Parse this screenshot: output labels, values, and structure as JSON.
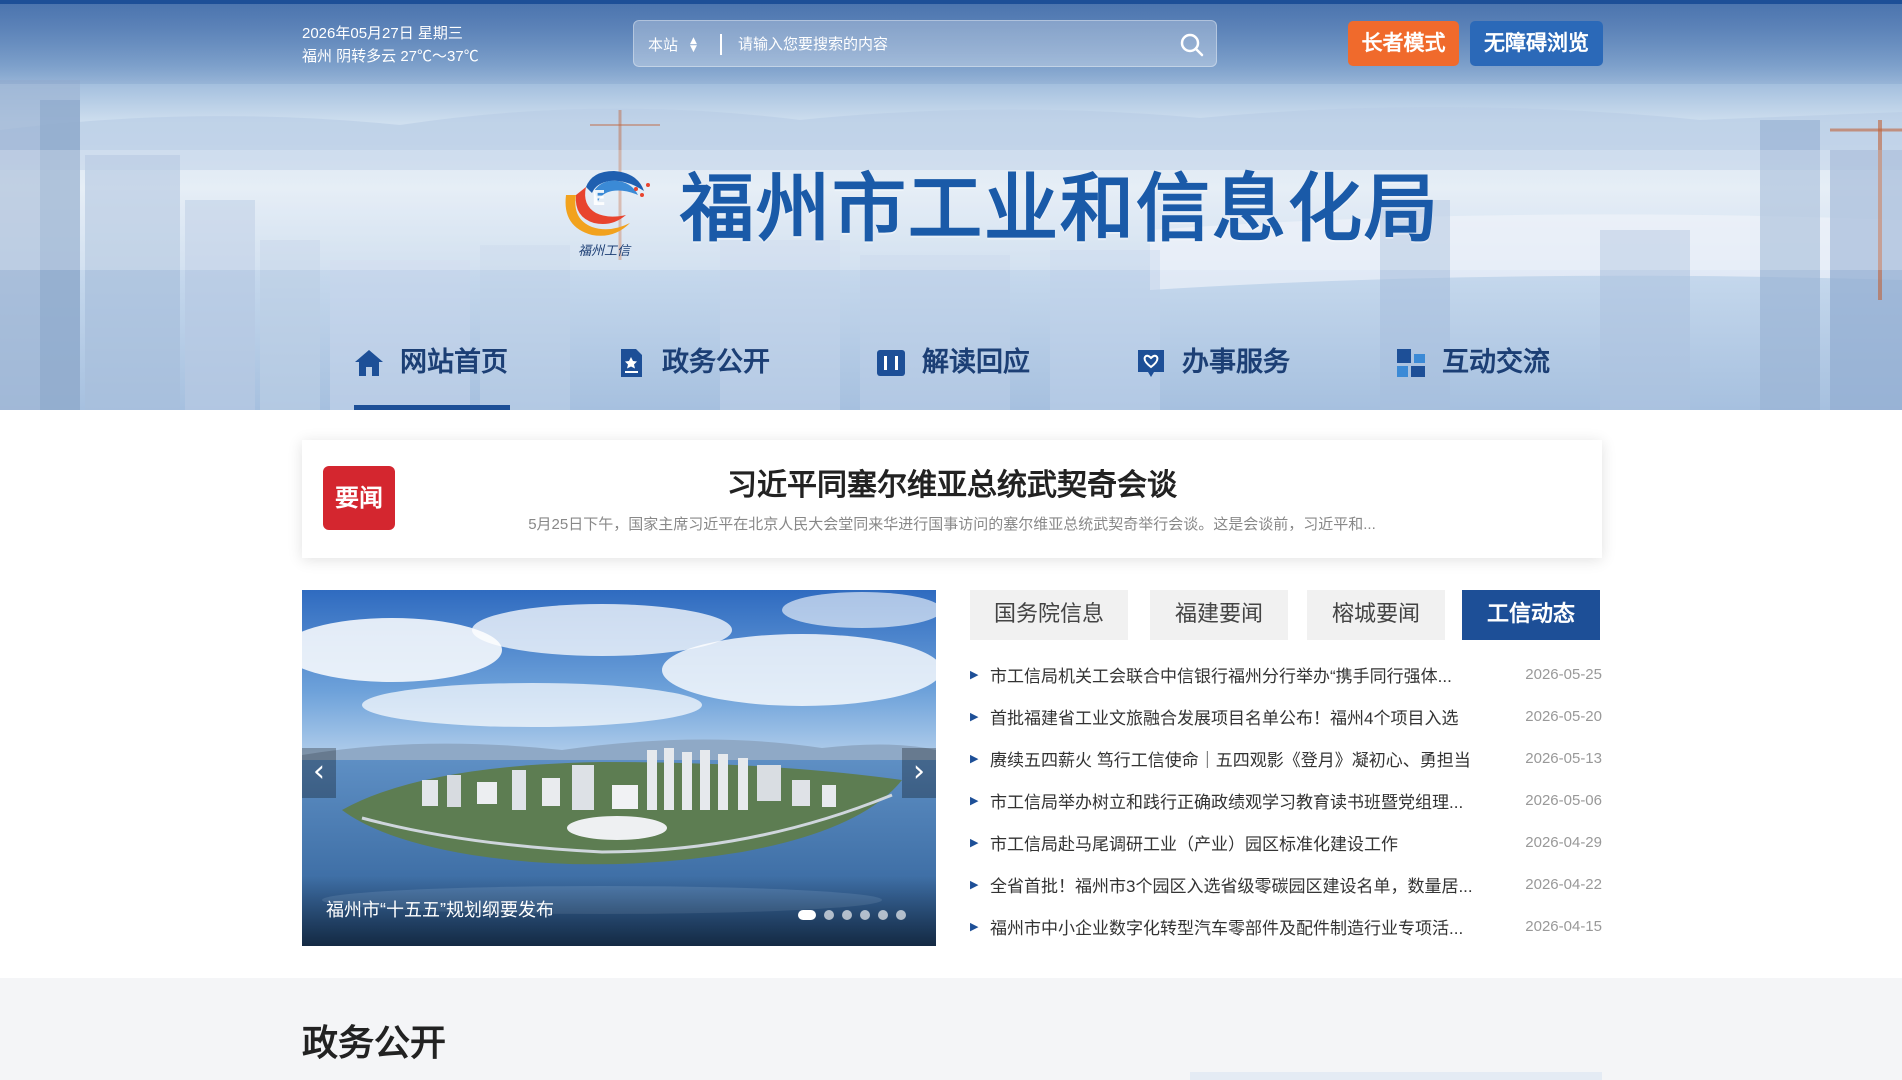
{
  "header": {
    "date": "2026年05月27日 星期三",
    "weather": "福州 阴转多云 27℃～37℃",
    "site_title": "福州市工业和信息化局",
    "logo_text": "福州工信",
    "search": {
      "scope": "本站",
      "placeholder": "请输入您要搜索的内容"
    },
    "buttons": {
      "elder_mode": "长者模式",
      "accessibility": "无障碍浏览"
    }
  },
  "nav": {
    "items": [
      {
        "label": "网站首页",
        "icon": "home-icon",
        "active": true
      },
      {
        "label": "政务公开",
        "icon": "document-icon",
        "active": false
      },
      {
        "label": "解读回应",
        "icon": "book-icon",
        "active": false
      },
      {
        "label": "办事服务",
        "icon": "service-heart-icon",
        "active": false
      },
      {
        "label": "互动交流",
        "icon": "interaction-icon",
        "active": false
      }
    ]
  },
  "headline": {
    "badge": "要闻",
    "title": "习近平同塞尔维亚总统武契奇会谈",
    "summary": "5月25日下午，国家主席习近平在北京人民大会堂同来华进行国事访问的塞尔维亚总统武契奇举行会谈。这是会谈前，习近平和..."
  },
  "carousel": {
    "caption": "福州市“十五五”规划纲要发布",
    "prev": "‹",
    "next": "›",
    "dot_count": 6,
    "active_dot": 1
  },
  "news": {
    "tabs": [
      {
        "label": "国务院信息",
        "active": false
      },
      {
        "label": "福建要闻",
        "active": false
      },
      {
        "label": "榕城要闻",
        "active": false
      },
      {
        "label": "工信动态",
        "active": true
      }
    ],
    "items": [
      {
        "title": "市工信局机关工会联合中信银行福州分行举办“携手同行强体...",
        "date": "2026-05-25"
      },
      {
        "title": "首批福建省工业文旅融合发展项目名单公布！福州4个项目入选",
        "date": "2026-05-20"
      },
      {
        "title": "赓续五四薪火 笃行工信使命｜五四观影《登月》凝初心、勇担当",
        "date": "2026-05-13"
      },
      {
        "title": "市工信局举办树立和践行正确政绩观学习教育读书班暨党组理...",
        "date": "2026-05-06"
      },
      {
        "title": "市工信局赴马尾调研工业（产业）园区标准化建设工作",
        "date": "2026-04-29"
      },
      {
        "title": "全省首批！福州市3个园区入选省级零碳园区建设名单，数量居...",
        "date": "2026-04-22"
      },
      {
        "title": "福州市中小企业数字化转型汽车零部件及配件制造行业专项活...",
        "date": "2026-04-15"
      }
    ]
  },
  "gov_section": {
    "title": "政务公开"
  },
  "colors": {
    "primary_blue": "#1d4f97",
    "title_blue": "#1a5aa8",
    "elder_orange": "#f06a2c",
    "access_blue": "#2b69b8",
    "badge_red": "#d4262f"
  }
}
